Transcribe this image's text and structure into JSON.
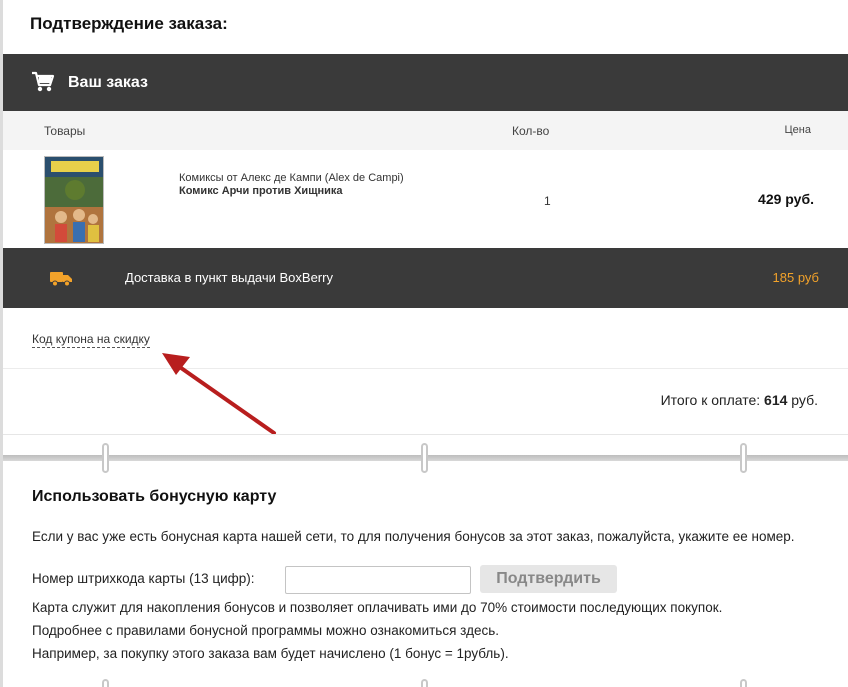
{
  "page": {
    "title": "Подтверждение заказа:"
  },
  "order": {
    "header_title": "Ваш заказ",
    "columns": {
      "goods": "Товары",
      "qty": "Кол-во",
      "price": "Цена"
    },
    "items": [
      {
        "publisher": "Комиксы от Алекс де Кампи (Alex de Campi)",
        "name": "Комикс Арчи против Хищника",
        "qty": "1",
        "price": "429 руб."
      }
    ],
    "delivery": {
      "label": "Доставка в пункт выдачи BoxBerry",
      "price": "185 руб"
    },
    "coupon_link": "Код купона на скидку",
    "total": {
      "label": "Итого к оплате:",
      "amount": "614",
      "currency": "руб."
    }
  },
  "bonus": {
    "title": "Использовать бонусную карту",
    "description": "Если у вас уже есть бонусная карта нашей сети, то для получения бонусов за этот заказ, пожалуйста, укажите ее номер.",
    "barcode_label": "Номер штрихкода карты (13 цифр):",
    "barcode_value": "",
    "confirm_label": "Подтвердить",
    "note1": "Карта служит для накопления бонусов и позволяет оплачивать ими до 70% стоимости последующих покупок.",
    "note2_prefix": "Подробнее с правилами бонусной программы можно ознакомиться",
    "note2_link": "здесь",
    "note2_suffix": ".",
    "note3": "Например, за покупку этого заказа вам будет начислено (1 бонус = 1рубль)."
  },
  "colors": {
    "dark_bar": "#3a3a3a",
    "accent_orange": "#f2a22a",
    "arrow_red": "#b81e1e"
  },
  "icons": {
    "cart": "cart-icon",
    "truck": "truck-icon",
    "annotation_arrow": "red-arrow"
  }
}
